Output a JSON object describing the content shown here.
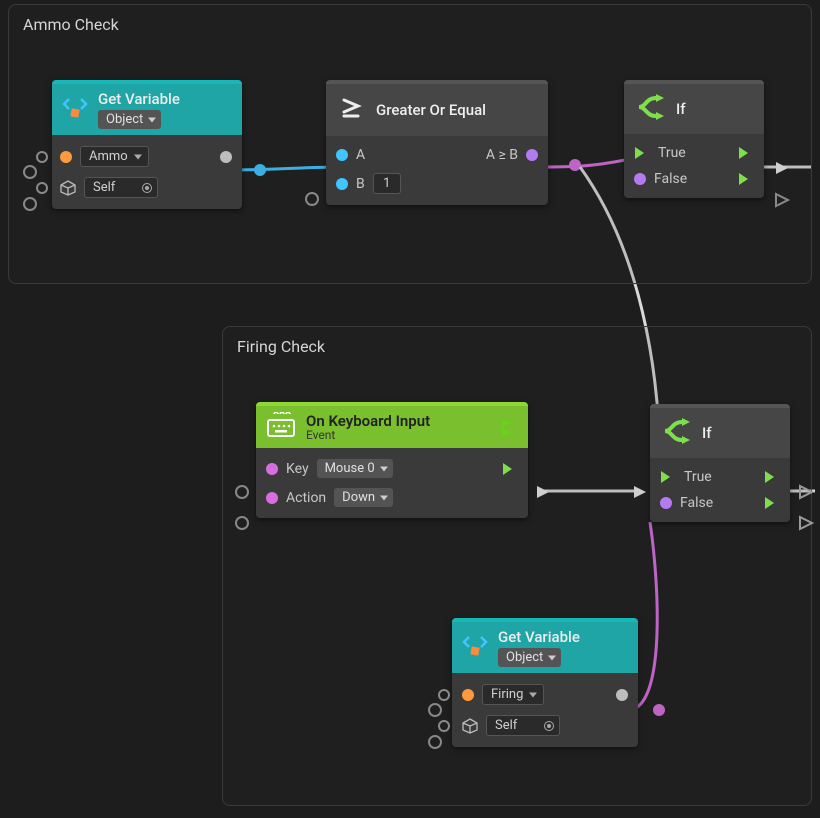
{
  "groups": {
    "ammo": {
      "title": "Ammo Check"
    },
    "firing": {
      "title": "Firing Check"
    }
  },
  "nodes": {
    "getvar1": {
      "title": "Get Variable",
      "subtype": "Object",
      "var_name": "Ammo",
      "target": "Self"
    },
    "ge": {
      "title": "Greater Or Equal",
      "a_label": "A",
      "b_label": "B",
      "b_value": "1",
      "out_label": "A ≥ B"
    },
    "if1": {
      "title": "If",
      "true_label": "True",
      "false_label": "False"
    },
    "keyinput": {
      "title": "On Keyboard Input",
      "subtitle": "Event",
      "key_label": "Key",
      "key_value": "Mouse 0",
      "action_label": "Action",
      "action_value": "Down"
    },
    "if2": {
      "title": "If",
      "true_label": "True",
      "false_label": "False"
    },
    "getvar2": {
      "title": "Get Variable",
      "subtype": "Object",
      "var_name": "Firing",
      "target": "Self"
    }
  }
}
